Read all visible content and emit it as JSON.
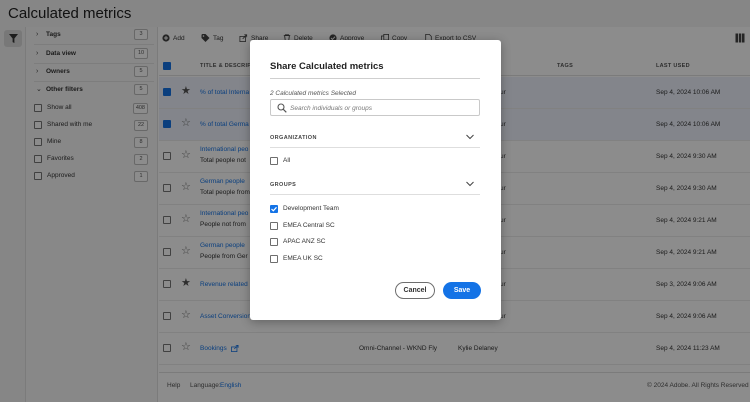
{
  "app": {
    "title": "Calculated metrics"
  },
  "filters": {
    "sections": [
      {
        "label": "Tags",
        "count": "3"
      },
      {
        "label": "Data view",
        "count": "10"
      },
      {
        "label": "Owners",
        "count": "5"
      },
      {
        "label": "Other filters",
        "count": "5"
      }
    ],
    "other": [
      {
        "label": "Show all",
        "count": "408"
      },
      {
        "label": "Shared with me",
        "count": "22"
      },
      {
        "label": "Mine",
        "count": "8"
      },
      {
        "label": "Favorites",
        "count": "2"
      },
      {
        "label": "Approved",
        "count": "1"
      }
    ]
  },
  "toolbar": {
    "add": "Add",
    "tag": "Tag",
    "share": "Share",
    "delete": "Delete",
    "approve": "Approve",
    "copy": "Copy",
    "export": "Export to CSV"
  },
  "table": {
    "headers": {
      "title": "TITLE & DESCRIPT",
      "tags": "TAGS",
      "last_used": "LAST USED"
    },
    "rows": [
      {
        "title": "% of total Interna",
        "desc": "",
        "owner": "ur",
        "last_used": "Sep 4, 2024 10:06 AM",
        "selected": true,
        "favorite": true
      },
      {
        "title": "% of total Germa",
        "desc": "",
        "owner": "ur",
        "last_used": "Sep 4, 2024 10:06 AM",
        "selected": true,
        "favorite": false
      },
      {
        "title": "International peo",
        "desc": "Total people not",
        "owner": "ur",
        "last_used": "Sep 4, 2024 9:30 AM",
        "selected": false,
        "favorite": false
      },
      {
        "title": "German people",
        "desc": "Total people from",
        "owner": "ur",
        "last_used": "Sep 4, 2024 9:30 AM",
        "selected": false,
        "favorite": false
      },
      {
        "title": "International peo",
        "desc": "People not from",
        "owner": "ur",
        "last_used": "Sep 4, 2024 9:21 AM",
        "selected": false,
        "favorite": false
      },
      {
        "title": "German people",
        "desc": "People from Ger",
        "owner": "ur",
        "last_used": "Sep 4, 2024 9:21 AM",
        "selected": false,
        "favorite": false
      },
      {
        "title": "Revenue related",
        "desc": "",
        "owner": "ur",
        "last_used": "Sep 3, 2024 9:06 AM",
        "selected": false,
        "favorite": true
      },
      {
        "title": "Asset Conversion",
        "desc": "",
        "owner": "ur",
        "last_used": "Sep 4, 2024 9:06 AM",
        "selected": false,
        "favorite": false
      },
      {
        "title": "Bookings",
        "desc": "",
        "dataview": "Omni-Channel - WKND Fly",
        "owner": "Kylie Delaney",
        "last_used": "Sep 4, 2024 11:23 AM",
        "selected": false,
        "favorite": false
      }
    ]
  },
  "footer": {
    "help": "Help",
    "language_label": "Language:",
    "language": "English",
    "copyright": "© 2024 Adobe. All Rights Reserved"
  },
  "dialog": {
    "title": "Share Calculated metrics",
    "subtitle": "2 Calculated metrics Selected",
    "search_placeholder": "Search individuals or groups",
    "org_heading": "ORGANIZATION",
    "all_label": "All",
    "groups_heading": "GROUPS",
    "groups": [
      {
        "label": "Development Team",
        "checked": true
      },
      {
        "label": "EMEA Central SC",
        "checked": false
      },
      {
        "label": "APAC ANZ SC",
        "checked": false
      },
      {
        "label": "EMEA UK SC",
        "checked": false
      }
    ],
    "cancel": "Cancel",
    "save": "Save"
  },
  "colors": {
    "accent": "#1473e6",
    "overlay": "rgba(0,0,0,0.45)"
  }
}
